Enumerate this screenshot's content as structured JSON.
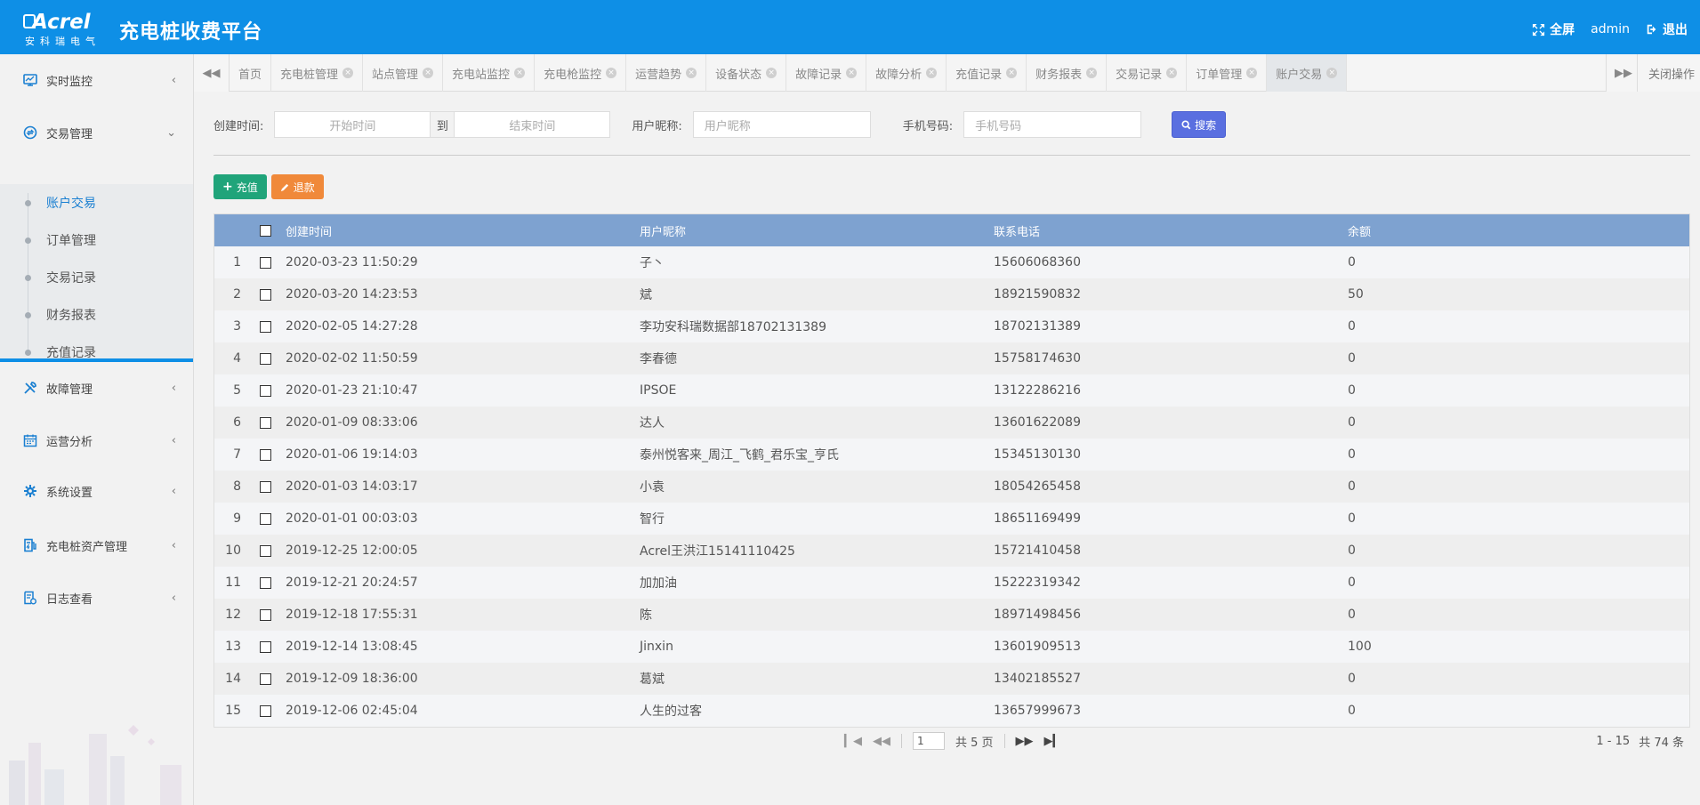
{
  "header": {
    "logo_text": "Acrel",
    "logo_sub": "安科瑞电气",
    "title": "充电桩收费平台",
    "fullscreen_label": "全屏",
    "user": "admin",
    "logout_label": "退出"
  },
  "sidebar": {
    "items": [
      {
        "label": "实时监控",
        "icon": "monitor-icon"
      },
      {
        "label": "交易管理",
        "icon": "transaction-icon"
      },
      {
        "label": "故障管理",
        "icon": "tools-icon"
      },
      {
        "label": "运营分析",
        "icon": "calendar-icon"
      },
      {
        "label": "系统设置",
        "icon": "gear-icon"
      },
      {
        "label": "充电桩资产管理",
        "icon": "charger-icon"
      },
      {
        "label": "日志查看",
        "icon": "log-icon"
      }
    ],
    "submenu": [
      "账户交易",
      "订单管理",
      "交易记录",
      "财务报表",
      "充值记录"
    ],
    "active_sub": "账户交易"
  },
  "tabs": {
    "items": [
      "首页",
      "充电桩管理",
      "站点管理",
      "充电站监控",
      "充电枪监控",
      "运营趋势",
      "设备状态",
      "故障记录",
      "故障分析",
      "充值记录",
      "财务报表",
      "交易记录",
      "订单管理",
      "账户交易"
    ],
    "active": "账户交易",
    "close_all_label": "关闭操作"
  },
  "filters": {
    "create_time_label": "创建时间:",
    "start_placeholder": "开始时间",
    "range_sep": "到",
    "end_placeholder": "结束时间",
    "nickname_label": "用户昵称:",
    "nickname_placeholder": "用户昵称",
    "phone_label": "手机号码:",
    "phone_placeholder": "手机号码",
    "search_label": "搜索"
  },
  "actions": {
    "recharge_label": "充值",
    "refund_label": "退款"
  },
  "table": {
    "columns": [
      "创建时间",
      "用户昵称",
      "联系电话",
      "余额"
    ],
    "rows": [
      {
        "idx": "1",
        "time": "2020-03-23 11:50:29",
        "name": "子丶",
        "phone": "15606068360",
        "balance": "0"
      },
      {
        "idx": "2",
        "time": "2020-03-20 14:23:53",
        "name": "斌",
        "phone": "18921590832",
        "balance": "50"
      },
      {
        "idx": "3",
        "time": "2020-02-05 14:27:28",
        "name": "李功安科瑞数据部18702131389",
        "phone": "18702131389",
        "balance": "0"
      },
      {
        "idx": "4",
        "time": "2020-02-02 11:50:59",
        "name": "李春德",
        "phone": "15758174630",
        "balance": "0"
      },
      {
        "idx": "5",
        "time": "2020-01-23 21:10:47",
        "name": "IPSOE",
        "phone": "13122286216",
        "balance": "0"
      },
      {
        "idx": "6",
        "time": "2020-01-09 08:33:06",
        "name": "达人",
        "phone": "13601622089",
        "balance": "0"
      },
      {
        "idx": "7",
        "time": "2020-01-06 19:14:03",
        "name": "泰州悦客来_周江_飞鹤_君乐宝_亨氏",
        "phone": "15345130130",
        "balance": "0"
      },
      {
        "idx": "8",
        "time": "2020-01-03 14:03:17",
        "name": "小袁",
        "phone": "18054265458",
        "balance": "0"
      },
      {
        "idx": "9",
        "time": "2020-01-01 00:03:03",
        "name": "智行",
        "phone": "18651169499",
        "balance": "0"
      },
      {
        "idx": "10",
        "time": "2019-12-25 12:00:05",
        "name": "Acrel王洪江15141110425",
        "phone": "15721410458",
        "balance": "0"
      },
      {
        "idx": "11",
        "time": "2019-12-21 20:24:57",
        "name": "加加油",
        "phone": "15222319342",
        "balance": "0"
      },
      {
        "idx": "12",
        "time": "2019-12-18 17:55:31",
        "name": "陈",
        "phone": "18971498456",
        "balance": "0"
      },
      {
        "idx": "13",
        "time": "2019-12-14 13:08:45",
        "name": "Jinxin",
        "phone": "13601909513",
        "balance": "100"
      },
      {
        "idx": "14",
        "time": "2019-12-09 18:36:00",
        "name": "葛斌",
        "phone": "13402185527",
        "balance": "0"
      },
      {
        "idx": "15",
        "time": "2019-12-06 02:45:04",
        "name": "人生的过客",
        "phone": "13657999673",
        "balance": "0"
      }
    ]
  },
  "pagination": {
    "current_page": "1",
    "total_pages_text": "共 5 页",
    "range_text": "1 - 15",
    "total_text": "共 74 条"
  },
  "colors": {
    "header": "#0e8fe6",
    "table_header": "#7ea2d0",
    "search_button": "#5a6fe0",
    "recharge_button": "#20a47a",
    "refund_button": "#f0893a",
    "active_link": "#1a7fd1"
  }
}
